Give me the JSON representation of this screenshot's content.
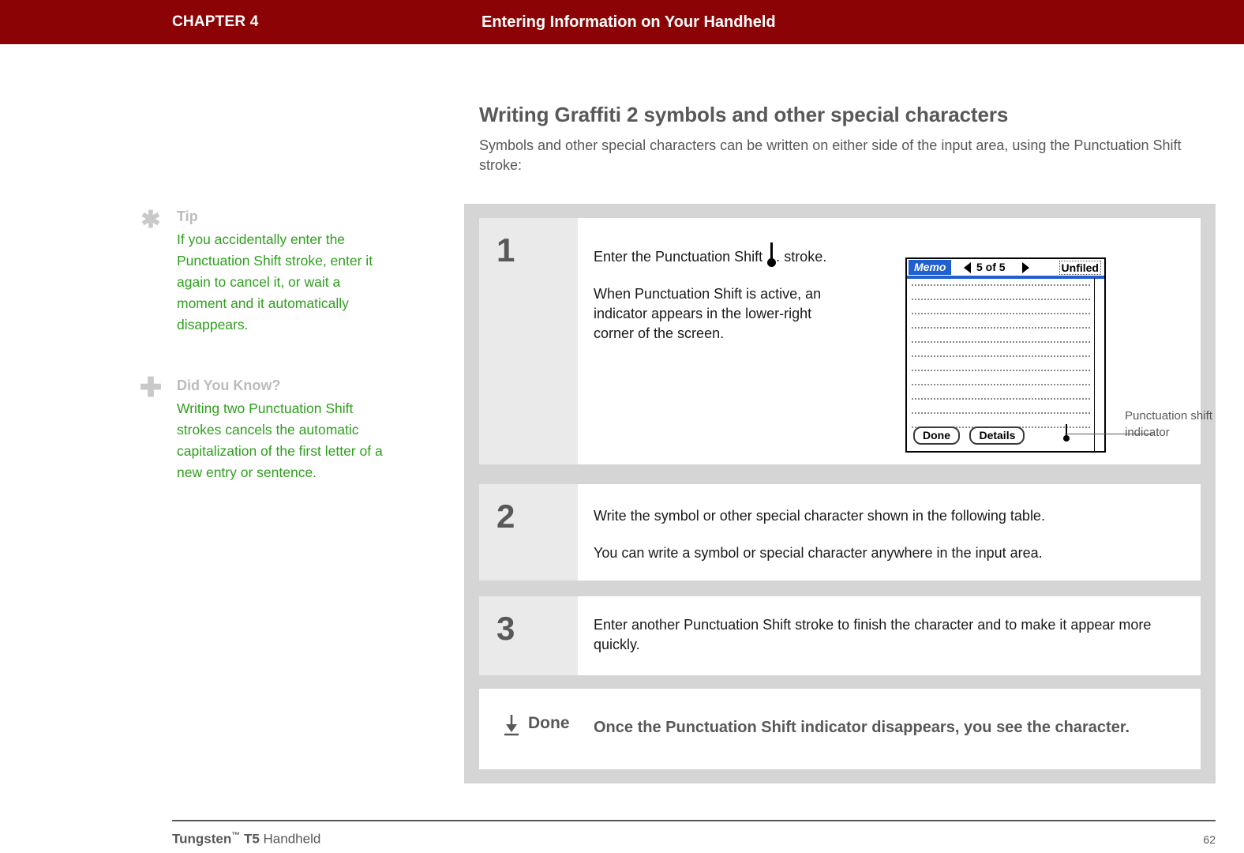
{
  "header": {
    "chapter_label": "CHAPTER 4",
    "chapter_title": "Entering Information on Your Handheld",
    "bar_color": "#8c0305",
    "text_color": "#ffffff"
  },
  "section": {
    "heading": "Writing Graffiti 2 symbols and other special characters",
    "intro": "Symbols and other special characters can be written on either side of the input area, using the Punctuation Shift stroke:"
  },
  "sidebar": {
    "notes": [
      {
        "icon": "asterisk-icon",
        "title": "Tip",
        "body": "If you accidentally enter the Punctuation Shift stroke, enter it again to cancel it, or wait a moment and it automatically disappears.",
        "body_color": "#2f9e1e"
      },
      {
        "icon": "plus-icon",
        "title": "Did You Know?",
        "body": "Writing two Punctuation Shift strokes cancels the automatic capitalization of the first letter of a new entry or sentence.",
        "body_color": "#2f9e1e"
      }
    ]
  },
  "steps": [
    {
      "number": "1",
      "paragraph_1_prefix": "Enter the Punctuation Shift",
      "paragraph_1_suffix": ".",
      "paragraph_1_line2": "stroke.",
      "paragraph_2": "When Punctuation Shift is active, an indicator appears in the lower-right corner of the screen."
    },
    {
      "number": "2",
      "paragraph_1": "Write the symbol or other special character shown in the following table.",
      "paragraph_2": "You can write a symbol or special character anywhere in the input area."
    },
    {
      "number": "3",
      "paragraph_1": "Enter another Punctuation Shift stroke to finish the character and to make it appear more quickly."
    }
  ],
  "done_row": {
    "icon": "down-arrow-to-bar-icon",
    "label": "Done",
    "text": "Once the Punctuation Shift indicator disappears, you see the character."
  },
  "device": {
    "app_name": "Memo",
    "prev_icon": "left-triangle-icon",
    "record_counter": "5 of 5",
    "next_icon": "right-triangle-icon",
    "category": "Unfiled",
    "titlebar_color": "#1f5fd0",
    "buttons": [
      "Done",
      "Details"
    ],
    "indicator_icon": "punctuation-shift-indicator-icon",
    "callout_label": "Punctuation shift indicator"
  },
  "footer": {
    "product_bold": "Tungsten",
    "product_tm": "™",
    "product_model": "T5",
    "product_suffix": "Handheld",
    "page_number": "62"
  }
}
